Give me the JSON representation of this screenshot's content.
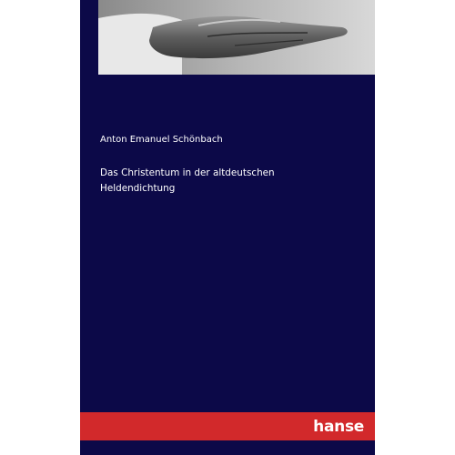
{
  "book": {
    "author": "Anton Emanuel Schönbach",
    "title_line1": "Das Christentum in der altdeutschen",
    "title_line2": "Heldendichtung",
    "publisher": "hanse"
  },
  "colors": {
    "cover_blue": "#0c0948",
    "stripe_red": "#d2292b",
    "text": "#ffffff"
  },
  "images": {
    "top_photo": "open-hand-photo"
  }
}
